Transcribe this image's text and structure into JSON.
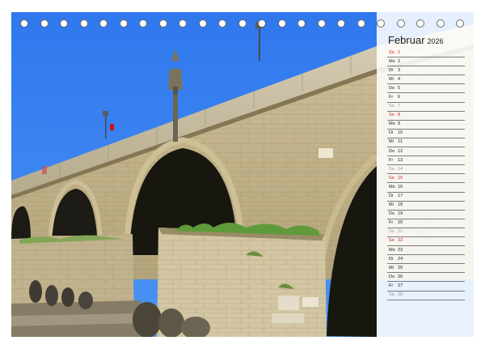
{
  "calendar": {
    "month": "Februar",
    "year": "2026",
    "days": [
      {
        "dn": "So",
        "d": "1",
        "type": "sunday"
      },
      {
        "dn": "Mo",
        "d": "2",
        "type": "weekday"
      },
      {
        "dn": "Di",
        "d": "3",
        "type": "weekday"
      },
      {
        "dn": "Mi",
        "d": "4",
        "type": "weekday"
      },
      {
        "dn": "Do",
        "d": "5",
        "type": "weekday"
      },
      {
        "dn": "Fr",
        "d": "6",
        "type": "weekday"
      },
      {
        "dn": "Sa",
        "d": "7",
        "type": "saturday"
      },
      {
        "dn": "So",
        "d": "8",
        "type": "sunday"
      },
      {
        "dn": "Mo",
        "d": "9",
        "type": "weekday"
      },
      {
        "dn": "Di",
        "d": "10",
        "type": "weekday"
      },
      {
        "dn": "Mi",
        "d": "11",
        "type": "weekday"
      },
      {
        "dn": "Do",
        "d": "12",
        "type": "weekday"
      },
      {
        "dn": "Fr",
        "d": "13",
        "type": "weekday"
      },
      {
        "dn": "Sa",
        "d": "14",
        "type": "saturday"
      },
      {
        "dn": "So",
        "d": "15",
        "type": "sunday"
      },
      {
        "dn": "Mo",
        "d": "16",
        "type": "weekday"
      },
      {
        "dn": "Di",
        "d": "17",
        "type": "weekday"
      },
      {
        "dn": "Mi",
        "d": "18",
        "type": "weekday"
      },
      {
        "dn": "Do",
        "d": "19",
        "type": "weekday"
      },
      {
        "dn": "Fr",
        "d": "20",
        "type": "weekday"
      },
      {
        "dn": "Sa",
        "d": "21",
        "type": "saturday"
      },
      {
        "dn": "So",
        "d": "22",
        "type": "sunday"
      },
      {
        "dn": "Mo",
        "d": "23",
        "type": "weekday"
      },
      {
        "dn": "Di",
        "d": "24",
        "type": "weekday"
      },
      {
        "dn": "Mi",
        "d": "25",
        "type": "weekday"
      },
      {
        "dn": "Do",
        "d": "26",
        "type": "weekday"
      },
      {
        "dn": "Fr",
        "d": "27",
        "type": "weekday"
      },
      {
        "dn": "Sa",
        "d": "28",
        "type": "saturday"
      }
    ]
  },
  "colors": {
    "sunday": "#d11a1a",
    "saturday": "#9a9a9a",
    "weekday": "#222222",
    "sky": "#3a82ee"
  }
}
